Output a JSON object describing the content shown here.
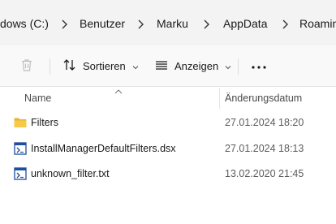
{
  "breadcrumb": {
    "items": [
      "dows (C:)",
      "Benutzer",
      "Marku",
      "AppData",
      "Roamin"
    ]
  },
  "toolbar": {
    "sort_label": "Sortieren",
    "view_label": "Anzeigen"
  },
  "columns": {
    "name": "Name",
    "modified": "Änderungsdatum"
  },
  "files": [
    {
      "name": "Filters",
      "modified": "27.01.2024 18:20",
      "icon": "folder-icon"
    },
    {
      "name": "InstallManagerDefaultFilters.dsx",
      "modified": "27.01.2024 18:13",
      "icon": "file-icon"
    },
    {
      "name": "unknown_filter.txt",
      "modified": "13.02.2020 21:45",
      "icon": "file-icon"
    }
  ],
  "colors": {
    "folder": "#f5c542",
    "file_blue": "#1f4e9c"
  }
}
